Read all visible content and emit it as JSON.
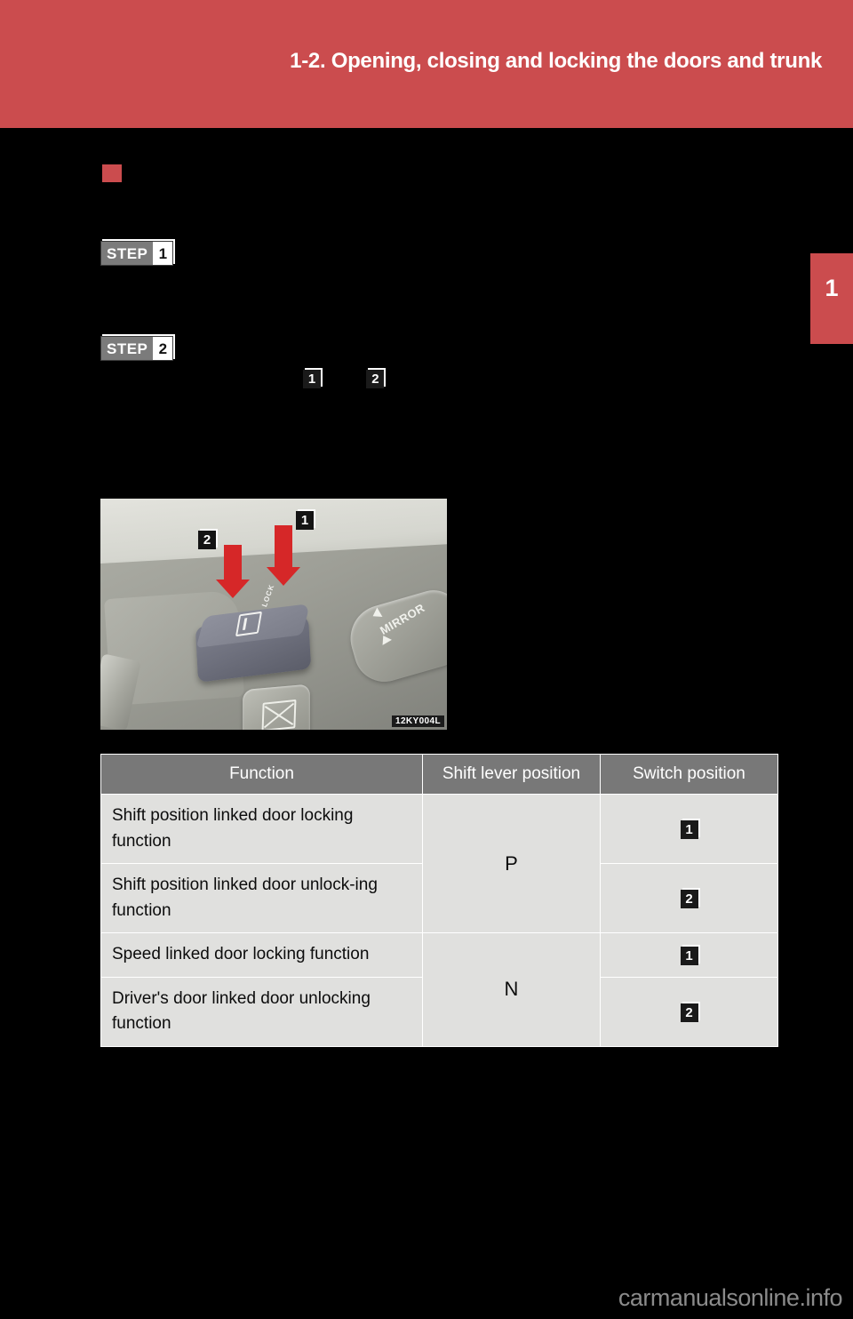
{
  "header": {
    "title": "1-2. Opening, closing and locking the doors and trunk",
    "banner_color": "#cb4c4e"
  },
  "chapter_tab": {
    "number": "1",
    "color": "#cb4c4e"
  },
  "section": {
    "bullet_color": "#cb4c4e",
    "heading": ""
  },
  "steps": [
    {
      "label": "STEP",
      "number": "1",
      "text": ""
    },
    {
      "label": "STEP",
      "number": "2",
      "text": ""
    }
  ],
  "inline_badges": {
    "note": "",
    "badge_1": "1",
    "badge_2": "2"
  },
  "illustration": {
    "code": "12KY004L",
    "mirror_label": "MIRROR",
    "lock_label": "LOCK",
    "callout_1": "1",
    "callout_2": "2"
  },
  "table": {
    "columns": [
      "Function",
      "Shift lever position",
      "Switch position"
    ],
    "rows": [
      {
        "function": "Shift position linked door locking function",
        "shift": "P",
        "shift_rowspan": 2,
        "switch": "1"
      },
      {
        "function": "Shift position linked door unlock-ing function",
        "shift": null,
        "switch": "2"
      },
      {
        "function": "Speed linked door locking function",
        "shift": "N",
        "shift_rowspan": 2,
        "switch": "1"
      },
      {
        "function": "Driver's door linked door unlocking function",
        "shift": null,
        "switch": "2"
      }
    ]
  },
  "footer": {
    "watermark": "carmanualsonline.info"
  }
}
